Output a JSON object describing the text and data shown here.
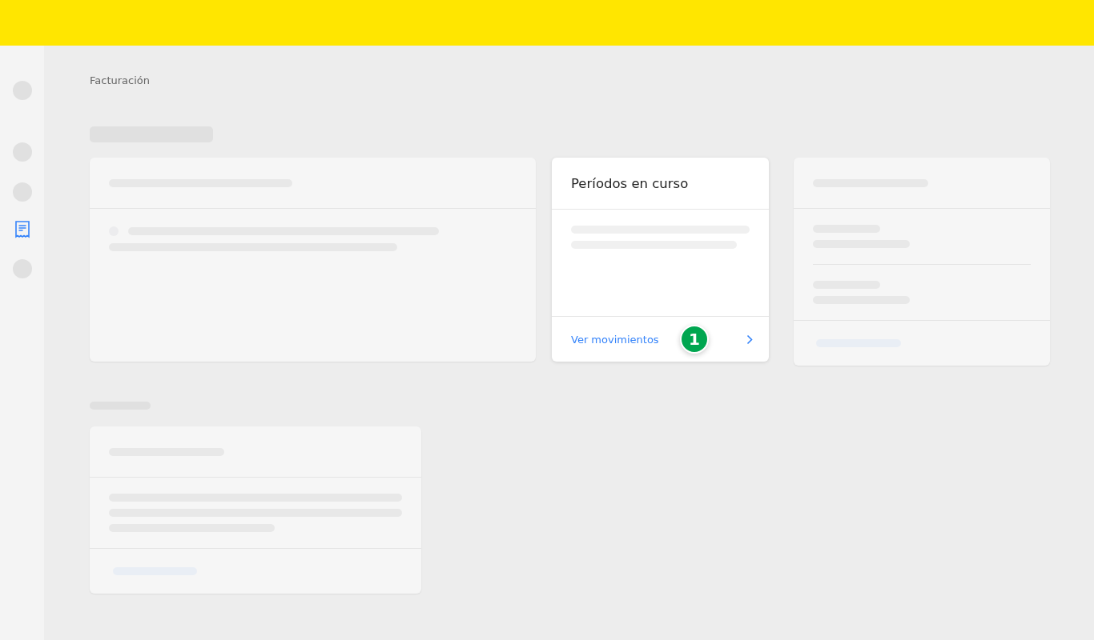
{
  "sidebar": {
    "items": [
      {
        "kind": "placeholder"
      },
      {
        "kind": "placeholder"
      },
      {
        "kind": "placeholder"
      },
      {
        "kind": "receipt",
        "selected": true
      },
      {
        "kind": "placeholder"
      }
    ]
  },
  "breadcrumb": "Facturación",
  "periods_card": {
    "title": "Períodos en curso",
    "link": "Ver movimientos",
    "step_badge": "1"
  }
}
